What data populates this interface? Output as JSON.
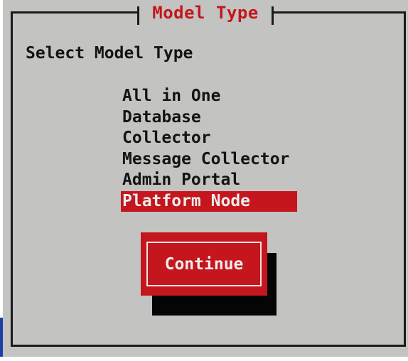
{
  "window": {
    "title": "Model Type"
  },
  "prompt": {
    "label": "Select Model Type"
  },
  "menu": {
    "items": [
      {
        "label": "All in One",
        "selected": false
      },
      {
        "label": "Database",
        "selected": false
      },
      {
        "label": "Collector",
        "selected": false
      },
      {
        "label": "Message Collector",
        "selected": false
      },
      {
        "label": "Admin Portal",
        "selected": false
      },
      {
        "label": "Platform Node",
        "selected": true
      }
    ]
  },
  "actions": {
    "continue_label": "Continue"
  },
  "colors": {
    "accent": "#c4161c",
    "background": "#c3c3c1",
    "text": "#141414",
    "shadow": "#050505"
  }
}
